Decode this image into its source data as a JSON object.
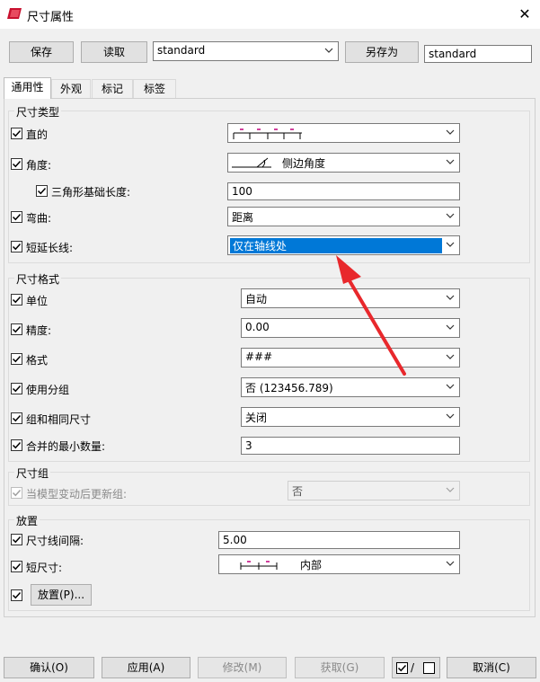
{
  "window": {
    "title": "尺寸属性"
  },
  "toolbar": {
    "save_label": "保存",
    "load_label": "读取",
    "style_combo_value": "standard",
    "save_as_label": "另存为",
    "save_as_name": "standard"
  },
  "tabs": [
    {
      "label": "通用性",
      "active": true
    },
    {
      "label": "外观"
    },
    {
      "label": "标记"
    },
    {
      "label": "标签"
    }
  ],
  "dimension_type": {
    "group_label": "尺寸类型",
    "straight": {
      "label": "直的",
      "checked": true,
      "icon": "dimension-line-ticks-icon"
    },
    "angle": {
      "label": "角度:",
      "checked": true,
      "value": "侧边角度",
      "icon": "angle-side-icon"
    },
    "triangle_base": {
      "label": "三角形基础长度:",
      "checked": true,
      "value": "100"
    },
    "curve": {
      "label": "弯曲:",
      "checked": true,
      "value": "距离"
    },
    "short_extension": {
      "label": "短延长线:",
      "checked": true,
      "value": "仅在轴线处"
    }
  },
  "dimension_format": {
    "group_label": "尺寸格式",
    "unit": {
      "label": "单位",
      "checked": true,
      "value": "自动"
    },
    "precision": {
      "label": "精度:",
      "checked": true,
      "value": "0.00"
    },
    "format": {
      "label": "格式",
      "checked": true,
      "value": "###"
    },
    "grouping": {
      "label": "使用分组",
      "checked": true,
      "value": "否 (123456.789)"
    },
    "combine_same": {
      "label": "组和相同尺寸",
      "checked": true,
      "value": "关闭"
    },
    "min_combine": {
      "label": "合并的最小数量:",
      "checked": true,
      "value": "3"
    }
  },
  "dimension_group": {
    "group_label": "尺寸组",
    "update_on_change": {
      "label": "当模型变动后更新组:",
      "checked": true,
      "disabled": true,
      "value": "否"
    }
  },
  "placement": {
    "group_label": "放置",
    "line_spacing": {
      "label": "尺寸线间隔:",
      "checked": true,
      "value": "5.00"
    },
    "short_dimension": {
      "label": "短尺寸:",
      "checked": true,
      "value": "内部",
      "icon": "short-dimension-icon"
    },
    "place_button_label": "放置(P)...",
    "place_checked": true
  },
  "footer": {
    "ok_label": "确认(O)",
    "apply_label": "应用(A)",
    "modify_label": "修改(M)",
    "get_label": "获取(G)",
    "toggle_label": "/",
    "cancel_label": "取消(C)"
  },
  "colors": {
    "selection": "#0078d7",
    "annotation_arrow": "#e8282c"
  }
}
